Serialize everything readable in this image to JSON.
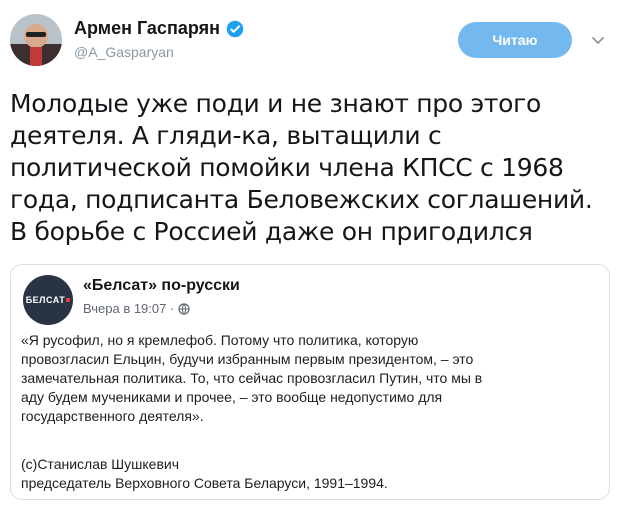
{
  "author": {
    "display_name": "Армен Гаспарян",
    "handle": "@A_Gasparyan",
    "verified": true,
    "avatar_icon": "user-avatar"
  },
  "follow_button": {
    "label": "Читаю",
    "color": "#73b9f0"
  },
  "menu_icon": "chevron-down-icon",
  "tweet_text_lines": [
    "Молодые уже поди и не знают про этого",
    "деятеля. А гляди-ка, вытащили с",
    "политической помойки члена КПСС с 1968",
    "года, подписанта Беловежских соглашений.",
    "В борьбе с Россией даже он пригодился"
  ],
  "embed": {
    "logo_text": "БЕЛСАТ",
    "page_name": "«Белсат» по-русски",
    "timestamp": "Вчера в 19:07 ·",
    "privacy_icon": "globe-icon",
    "body_lines": [
      "«Я русофил, но я кремлефоб. Потому что политика, которую",
      "провозгласил Ельцин, будучи избранным первым президентом, – это",
      "замечательная политика. То, что сейчас провозгласил Путин, что мы в",
      "аду будем мучениками и прочее, – это вообще недопустимо для",
      "государственного деятеля»."
    ],
    "signature_lines": [
      "(c)Станислав Шушкевич",
      "председатель Верховного Совета Беларуси, 1991–1994."
    ]
  },
  "colors": {
    "verified_badge": "#1da1f2",
    "handle": "#8899a6",
    "card_border": "#d9dfe4"
  }
}
